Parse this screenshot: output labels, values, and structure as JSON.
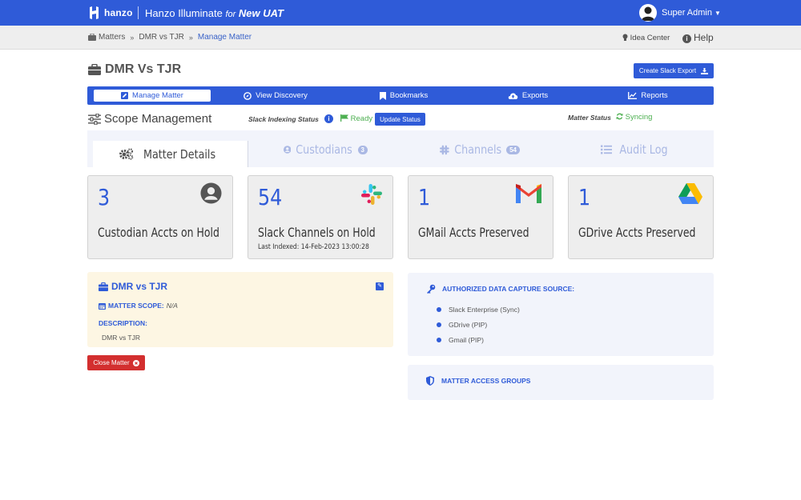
{
  "header": {
    "logo_text": "hanzo",
    "app_name": "Hanzo Illuminate",
    "for_text": "for",
    "env_name": "New UAT",
    "user_name": "Super Admin",
    "brand_color": "#2f5bd8"
  },
  "breadcrumb": {
    "items": [
      "Matters",
      "DMR vs TJR",
      "Manage Matter"
    ],
    "icon": "briefcase-icon"
  },
  "utility": {
    "idea_center": "Idea Center",
    "help": "Help"
  },
  "matter": {
    "title": "DMR Vs TJR",
    "export_button": "Create Slack Export"
  },
  "tabs": [
    {
      "label": "Manage Matter",
      "icon": "edit-icon",
      "active": true
    },
    {
      "label": "View Discovery",
      "icon": "compass-icon",
      "active": false
    },
    {
      "label": "Bookmarks",
      "icon": "bookmark-icon",
      "active": false
    },
    {
      "label": "Exports",
      "icon": "cloud-upload-icon",
      "active": false
    },
    {
      "label": "Reports",
      "icon": "line-chart-icon",
      "active": false
    }
  ],
  "scope": {
    "title": "Scope Management",
    "indexing_label": "Slack Indexing Status",
    "indexing_value": "Ready",
    "update_button": "Update Status",
    "matter_status_label": "Matter Status",
    "matter_status_value": "Syncing"
  },
  "subtabs": [
    {
      "label": "Matter Details",
      "badge": null,
      "active": true
    },
    {
      "label": "Custodians",
      "badge": "3",
      "active": false
    },
    {
      "label": "Channels",
      "badge": "54",
      "active": false
    },
    {
      "label": "Audit Log",
      "badge": null,
      "active": false
    }
  ],
  "cards": [
    {
      "value": "3",
      "label": "Custodian Accts on Hold",
      "sub": "",
      "icon": "user-circle-icon"
    },
    {
      "value": "54",
      "label": "Slack Channels on Hold",
      "sub": "Last Indexed: 14-Feb-2023 13:00:28",
      "icon": "slack-icon"
    },
    {
      "value": "1",
      "label": "GMail Accts Preserved",
      "sub": "",
      "icon": "gmail-icon"
    },
    {
      "value": "1",
      "label": "GDrive Accts Preserved",
      "sub": "",
      "icon": "gdrive-icon"
    }
  ],
  "details": {
    "title": "DMR vs TJR",
    "scope_label": "MATTER SCOPE:",
    "scope_value": "N/A",
    "description_label": "DESCRIPTION:",
    "description_value": "DMR vs TJR",
    "close_button": "Close Matter"
  },
  "sources": {
    "title": "AUTHORIZED DATA CAPTURE SOURCE:",
    "items": [
      "Slack Enterprise (Sync)",
      "GDrive (PIP)",
      "Gmail (PIP)"
    ]
  },
  "groups": {
    "title": "MATTER ACCESS GROUPS"
  }
}
